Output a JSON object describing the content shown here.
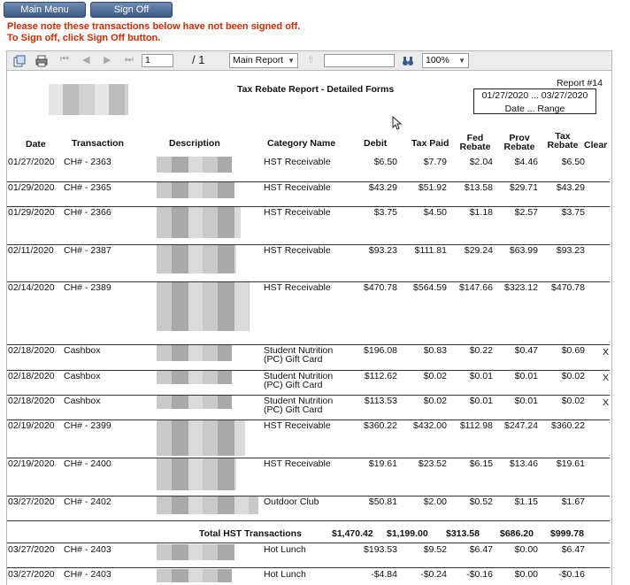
{
  "top": {
    "main_menu": "Main Menu",
    "sign_off": "Sign Off",
    "warning1": "Please note these transactions below have not been signed off.",
    "warning2": "To Sign off, click Sign Off button."
  },
  "toolbar": {
    "page_value": "1",
    "page_total": "/ 1",
    "report_select": "Main Report",
    "search_value": "",
    "zoom": "100%"
  },
  "report": {
    "title": "Tax Rebate Report - Detailed Forms",
    "number": "Report #14",
    "range_dates": "01/27/2020 ... 03/27/2020",
    "range_label": "Date ... Range"
  },
  "columns": {
    "date": "Date",
    "transaction": "Transaction",
    "description": "Description",
    "category": "Category Name",
    "debit": "Debit",
    "tax_paid": "Tax Paid",
    "fed1": "Fed",
    "fed2": "Rebate",
    "prov1": "Prov",
    "prov2": "Rebate",
    "tax1": "Tax",
    "tax2": "Rebate",
    "clear": "Clear"
  },
  "rows": [
    {
      "date": "01/27/2020",
      "trans": "CH# - 2363",
      "cat1": "HST Receivable",
      "cat2": "",
      "debit": "$6.50",
      "tax": "$7.79",
      "fed": "$2.04",
      "prov": "$4.46",
      "rebate": "$6.50",
      "clear": ""
    },
    {
      "date": "01/29/2020",
      "trans": "CH# - 2365",
      "cat1": "HST Receivable",
      "cat2": "",
      "debit": "$43.29",
      "tax": "$51.92",
      "fed": "$13.58",
      "prov": "$29.71",
      "rebate": "$43.29",
      "clear": ""
    },
    {
      "date": "01/29/2020",
      "trans": "CH# - 2366",
      "cat1": "HST Receivable",
      "cat2": "",
      "debit": "$3.75",
      "tax": "$4.50",
      "fed": "$1.18",
      "prov": "$2.57",
      "rebate": "$3.75",
      "clear": ""
    },
    {
      "date": "02/11/2020",
      "trans": "CH# - 2387",
      "cat1": "HST Receivable",
      "cat2": "",
      "debit": "$93.23",
      "tax": "$111.81",
      "fed": "$29.24",
      "prov": "$63.99",
      "rebate": "$93.23",
      "clear": ""
    },
    {
      "date": "02/14/2020",
      "trans": "CH# - 2389",
      "cat1": "HST Receivable",
      "cat2": "",
      "debit": "$470.78",
      "tax": "$564.59",
      "fed": "$147.66",
      "prov": "$323.12",
      "rebate": "$470.78",
      "clear": ""
    },
    {
      "date": "02/18/2020",
      "trans": "Cashbox",
      "cat1": "Student Nutrition",
      "cat2": "(PC) Gift Card",
      "debit": "$196.08",
      "tax": "$0.83",
      "fed": "$0.22",
      "prov": "$0.47",
      "rebate": "$0.69",
      "clear": "X"
    },
    {
      "date": "02/18/2020",
      "trans": "Cashbox",
      "cat1": "Student Nutrition",
      "cat2": "(PC) Gift Card",
      "debit": "$112.62",
      "tax": "$0.02",
      "fed": "$0.01",
      "prov": "$0.01",
      "rebate": "$0.02",
      "clear": "X"
    },
    {
      "date": "02/18/2020",
      "trans": "Cashbox",
      "cat1": "Student Nutrition",
      "cat2": "(PC) Gift Card",
      "debit": "$113.53",
      "tax": "$0.02",
      "fed": "$0.01",
      "prov": "$0.01",
      "rebate": "$0.02",
      "clear": "X"
    },
    {
      "date": "02/19/2020",
      "trans": "CH# - 2399",
      "cat1": "HST Receivable",
      "cat2": "",
      "debit": "$360.22",
      "tax": "$432.00",
      "fed": "$112.98",
      "prov": "$247.24",
      "rebate": "$360.22",
      "clear": ""
    },
    {
      "date": "02/19/2020",
      "trans": "CH# - 2400",
      "cat1": "HST Receivable",
      "cat2": "",
      "debit": "$19.61",
      "tax": "$23.52",
      "fed": "$6.15",
      "prov": "$13.46",
      "rebate": "$19.61",
      "clear": ""
    },
    {
      "date": "03/27/2020",
      "trans": "CH# - 2402",
      "cat1": "Outdoor Club",
      "cat2": "",
      "debit": "$50.81",
      "tax": "$2.00",
      "fed": "$0.52",
      "prov": "$1.15",
      "rebate": "$1.67",
      "clear": ""
    },
    {
      "date": "03/27/2020",
      "trans": "CH# - 2403",
      "cat1": "Hot Lunch",
      "cat2": "",
      "debit": "$193.53",
      "tax": "$9.52",
      "fed": "$6.47",
      "prov": "$0.00",
      "rebate": "$6.47",
      "clear": ""
    },
    {
      "date": "03/27/2020",
      "trans": "CH# - 2403",
      "cat1": "Hot Lunch",
      "cat2": "",
      "debit": "-$4.84",
      "tax": "-$0.24",
      "fed": "-$0.16",
      "prov": "$0.00",
      "rebate": "-$0.16",
      "clear": ""
    }
  ],
  "total": {
    "label": "Total HST Transactions",
    "debit": "$1,470.42",
    "tax": "$1,199.00",
    "fed": "$313.58",
    "prov": "$686.20",
    "rebate": "$999.78"
  }
}
